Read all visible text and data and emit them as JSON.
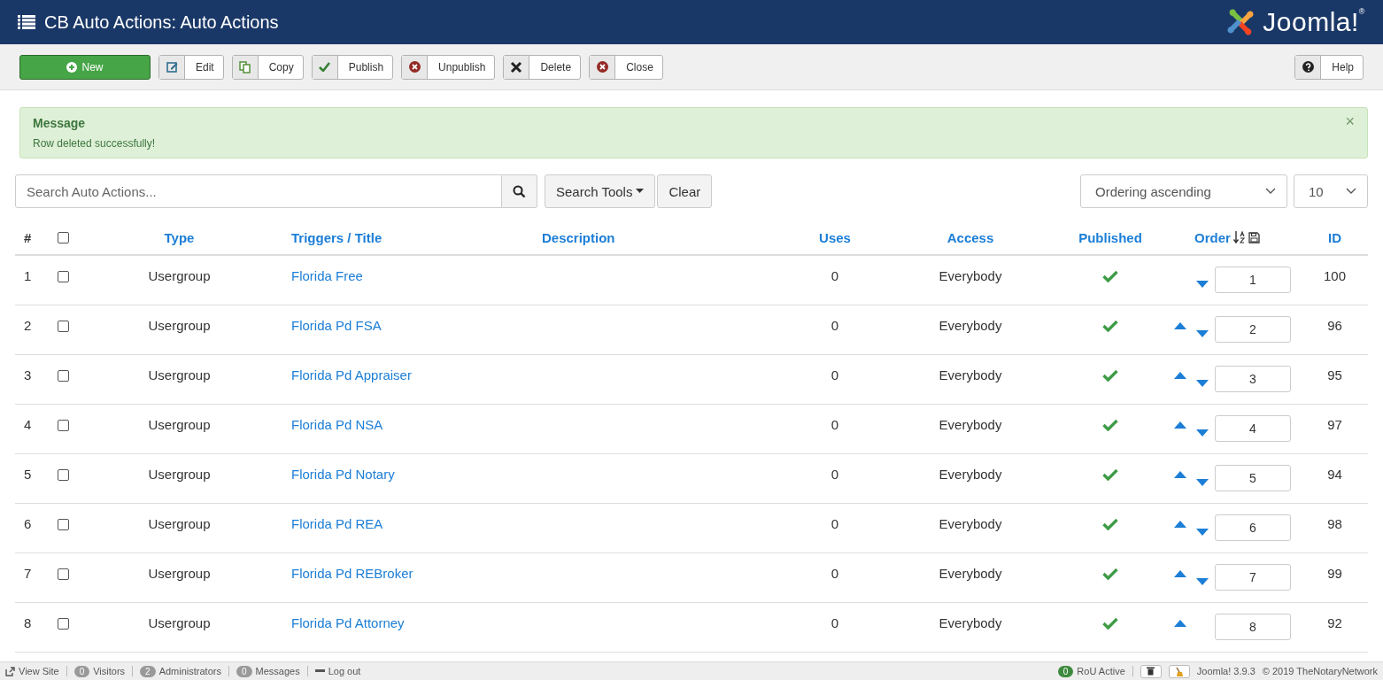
{
  "header": {
    "title": "CB Auto Actions: Auto Actions",
    "logo_text": "Joomla!$^{®}$"
  },
  "toolbar": {
    "buttons": [
      {
        "label": "New",
        "kind": "new"
      },
      {
        "label": "Edit",
        "kind": "edit"
      },
      {
        "label": "Copy",
        "kind": "copy"
      },
      {
        "label": "Publish",
        "kind": "publish"
      },
      {
        "label": "Unpublish",
        "kind": "unpublish"
      },
      {
        "label": "Delete",
        "kind": "delete"
      },
      {
        "label": "Close",
        "kind": "close"
      }
    ],
    "help": {
      "label": "Help",
      "kind": "help"
    }
  },
  "message": {
    "heading": "Message",
    "text": "Row deleted successfully!",
    "close": "×"
  },
  "filters": {
    "search_placeholder": "Search Auto Actions...",
    "search_tools": "Search Tools",
    "clear": "Clear",
    "ordering": "Ordering ascending",
    "limit": "10"
  },
  "table": {
    "columns": [
      {
        "label": "#",
        "kind": "plain"
      },
      {
        "kind": "checkbox",
        "checked": false
      },
      {
        "label": "Type",
        "kind": "sort"
      },
      {
        "label": "Triggers / Title",
        "kind": "sort"
      },
      {
        "label": "Description",
        "kind": "sort"
      },
      {
        "label": "Uses",
        "kind": "sort"
      },
      {
        "label": "Access",
        "kind": "sort"
      },
      {
        "label": "Published",
        "kind": "sort"
      },
      {
        "label": "Order",
        "kind": "order"
      },
      {
        "label": "ID",
        "kind": "sort"
      }
    ],
    "rows": [
      {
        "num": "1",
        "checked": false,
        "type": "Usergroup",
        "title": "Florida Free",
        "uses": "0",
        "access": "Everybody",
        "published": true,
        "move_up": false,
        "move_down": true,
        "order": "1",
        "id": "100"
      },
      {
        "num": "2",
        "checked": false,
        "type": "Usergroup",
        "title": "Florida Pd FSA",
        "uses": "0",
        "access": "Everybody",
        "published": true,
        "move_up": true,
        "move_down": true,
        "order": "2",
        "id": "96"
      },
      {
        "num": "3",
        "checked": false,
        "type": "Usergroup",
        "title": "Florida Pd Appraiser",
        "uses": "0",
        "access": "Everybody",
        "published": true,
        "move_up": true,
        "move_down": true,
        "order": "3",
        "id": "95"
      },
      {
        "num": "4",
        "checked": false,
        "type": "Usergroup",
        "title": "Florida Pd NSA",
        "uses": "0",
        "access": "Everybody",
        "published": true,
        "move_up": true,
        "move_down": true,
        "order": "4",
        "id": "97"
      },
      {
        "num": "5",
        "checked": false,
        "type": "Usergroup",
        "title": "Florida Pd Notary",
        "uses": "0",
        "access": "Everybody",
        "published": true,
        "move_up": true,
        "move_down": true,
        "order": "5",
        "id": "94"
      },
      {
        "num": "6",
        "checked": false,
        "type": "Usergroup",
        "title": "Florida Pd REA",
        "uses": "0",
        "access": "Everybody",
        "published": true,
        "move_up": true,
        "move_down": true,
        "order": "6",
        "id": "98"
      },
      {
        "num": "7",
        "checked": false,
        "type": "Usergroup",
        "title": "Florida Pd REBroker",
        "uses": "0",
        "access": "Everybody",
        "published": true,
        "move_up": true,
        "move_down": true,
        "order": "7",
        "id": "99"
      },
      {
        "num": "8",
        "checked": false,
        "type": "Usergroup",
        "title": "Florida Pd Attorney",
        "uses": "0",
        "access": "Everybody",
        "published": true,
        "move_up": true,
        "move_down": false,
        "order": "8",
        "id": "92"
      }
    ]
  },
  "status_bar": {
    "left": [
      {
        "kind": "link",
        "label": "View Site"
      },
      {
        "kind": "count",
        "count": "0",
        "label": "Visitors"
      },
      {
        "kind": "count",
        "count": "2",
        "label": "Administrators"
      },
      {
        "kind": "count",
        "count": "0",
        "label": "Messages"
      },
      {
        "kind": "logout",
        "label": "Log out"
      }
    ],
    "right": [
      {
        "kind": "active",
        "count": "0",
        "label": "RoU Active"
      },
      {
        "kind": "cache-button"
      },
      {
        "kind": "clean-button"
      },
      {
        "kind": "text",
        "label": "Joomla! 3.9.3"
      },
      {
        "kind": "text",
        "label": "© 2019 TheNotaryNetwork"
      }
    ]
  }
}
